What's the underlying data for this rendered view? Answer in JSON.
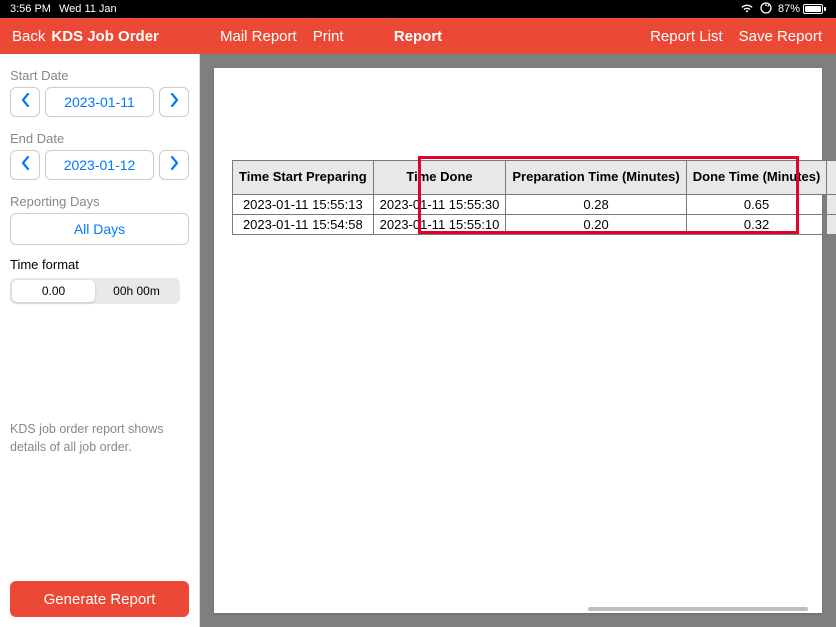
{
  "status_bar": {
    "time": "3:56 PM",
    "date": "Wed 11 Jan",
    "battery_pct": "87%"
  },
  "header": {
    "back": "Back",
    "title": "KDS Job Order",
    "mail_report": "Mail Report",
    "print": "Print",
    "center": "Report",
    "report_list": "Report List",
    "save_report": "Save Report"
  },
  "sidebar": {
    "start_date_label": "Start Date",
    "start_date": "2023-01-11",
    "end_date_label": "End Date",
    "end_date": "2023-01-12",
    "reporting_days_label": "Reporting Days",
    "all_days": "All Days",
    "time_format_label": "Time format",
    "time_format_opt1": "0.00",
    "time_format_opt2": "00h 00m",
    "description": "KDS job order report shows details of all job order.",
    "generate": "Generate Report"
  },
  "table": {
    "headers": {
      "time_start": "Time Start Preparing",
      "time_done": "Time Done",
      "prep_time": "Preparation Time (Minutes)",
      "done_time": "Done Time (Minutes)"
    },
    "rows": [
      {
        "start": "2023-01-11 15:55:13",
        "done": "2023-01-11 15:55:30",
        "prep": "0.28",
        "dtime": "0.65"
      },
      {
        "start": "2023-01-11 15:54:58",
        "done": "2023-01-11 15:55:10",
        "prep": "0.20",
        "dtime": "0.32"
      }
    ]
  }
}
